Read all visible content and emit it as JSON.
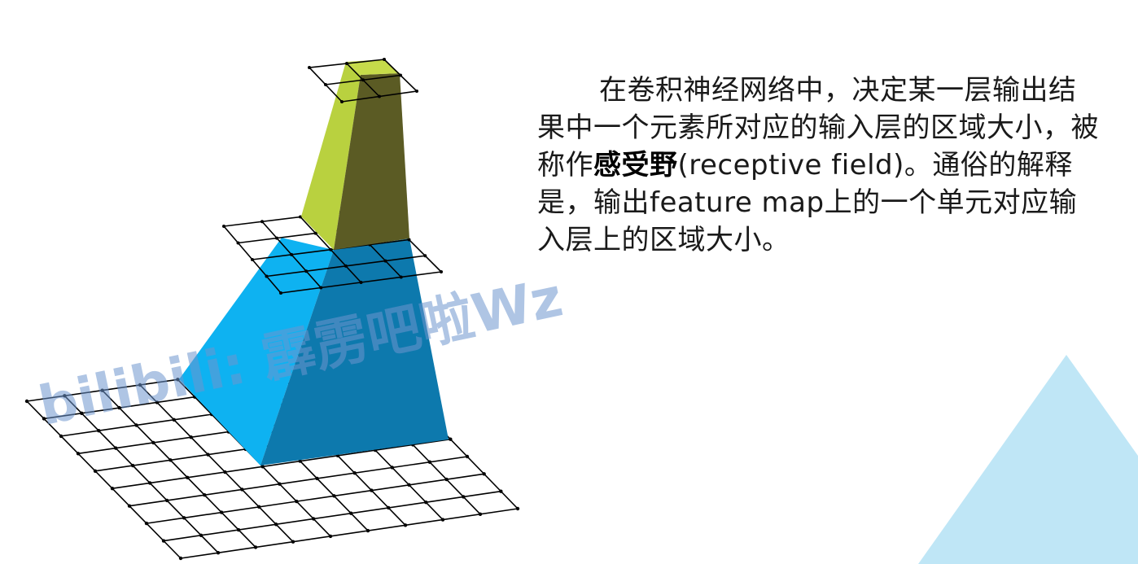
{
  "text": {
    "part1": "在卷积神经网络中，决定某一层输出结果中一个元素所对应的输入层的区域大小，被称作",
    "term": "感受野",
    "part2": "(receptive field)。通俗的解释是，输出feature map上的一个单元对应输入层上的区域大小。"
  },
  "watermark": "bilibili: 霹雳吧啦Wz",
  "colors": {
    "green_light": "#b9d13f",
    "green_dark": "#5b5b24",
    "blue_light": "#0eb2f1",
    "blue_dark": "#0d79ad",
    "accent_triangle": "#bfe6f6"
  }
}
